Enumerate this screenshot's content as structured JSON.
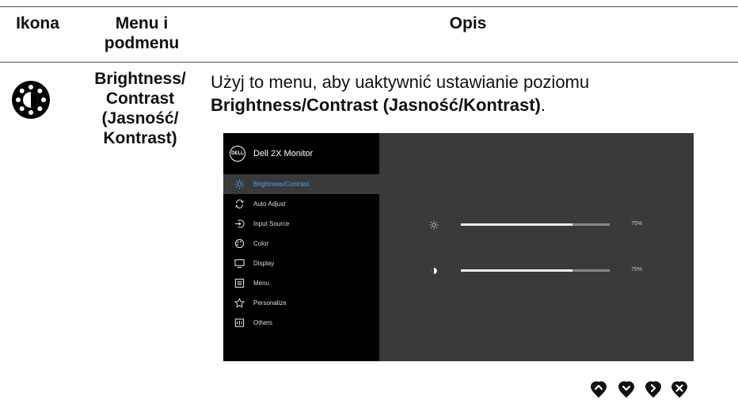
{
  "table": {
    "headers": {
      "icon": "Ikona",
      "menu": "Menu i podmenu",
      "desc": "Opis"
    },
    "row": {
      "icon_name": "brightness-contrast-icon",
      "menu_name": "Brightness/ Contrast (Jasność/ Kontrast)",
      "desc_intro": "Użyj to menu, aby uaktywnić ustawianie poziomu",
      "desc_bold": "Brightness/Contrast (Jasność/Kontrast)",
      "desc_end": "."
    }
  },
  "osd": {
    "logo_text": "DELL",
    "title": "Dell 2X Monitor",
    "menu_items": [
      {
        "label": "Brightness/Contrast",
        "icon": "sun-icon",
        "active": true
      },
      {
        "label": "Auto Adjust",
        "icon": "auto-adjust-icon",
        "active": false
      },
      {
        "label": "Input Source",
        "icon": "input-source-icon",
        "active": false
      },
      {
        "label": "Color",
        "icon": "color-palette-icon",
        "active": false
      },
      {
        "label": "Display",
        "icon": "display-icon",
        "active": false
      },
      {
        "label": "Menu",
        "icon": "menu-icon",
        "active": false
      },
      {
        "label": "Personalize",
        "icon": "star-icon",
        "active": false
      },
      {
        "label": "Others",
        "icon": "others-icon",
        "active": false
      }
    ],
    "sliders": [
      {
        "name": "brightness",
        "icon": "sun-icon",
        "value_percent": 75,
        "value_label": "75%"
      },
      {
        "name": "contrast",
        "icon": "contrast-icon",
        "value_percent": 75,
        "value_label": "75%"
      }
    ],
    "colors": {
      "active_text": "#4aa3ff",
      "panel": "#3a3a3a",
      "sidebar": "#000000"
    }
  },
  "nav_buttons": [
    {
      "name": "up-button",
      "icon": "chevron-up-icon"
    },
    {
      "name": "down-button",
      "icon": "chevron-down-icon"
    },
    {
      "name": "right-button",
      "icon": "chevron-right-icon"
    },
    {
      "name": "close-button",
      "icon": "close-icon"
    }
  ]
}
